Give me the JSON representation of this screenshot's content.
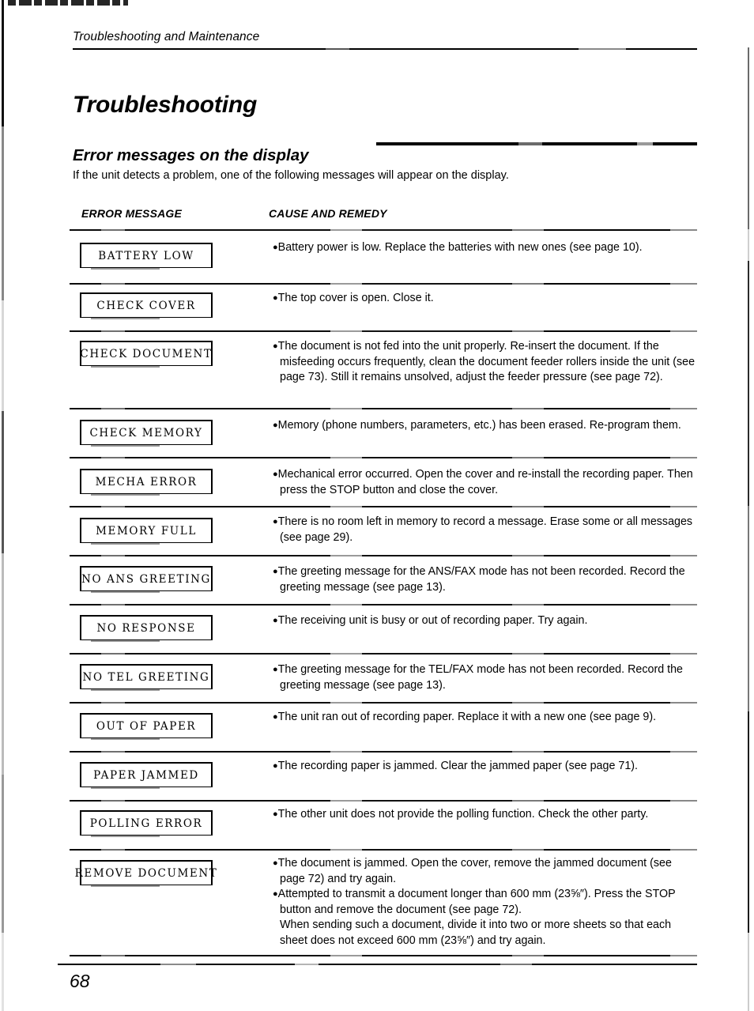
{
  "page": {
    "running_header": "Troubleshooting and Maintenance",
    "chapter_title": "Troubleshooting",
    "section_title": "Error messages on the display",
    "intro": "If the unit detects a problem, one of the following messages will appear on the display.",
    "page_number": "68"
  },
  "table": {
    "headers": {
      "error_message": "ERROR MESSAGE",
      "cause_and_remedy": "CAUSE AND REMEDY"
    },
    "rows": [
      {
        "display": "BATTERY LOW",
        "lines": [
          {
            "bullet": true,
            "text": "Battery power is low. Replace the batteries with new ones (see page 10)."
          }
        ]
      },
      {
        "display": "CHECK COVER",
        "lines": [
          {
            "bullet": true,
            "text": "The top cover is open. Close it."
          }
        ]
      },
      {
        "display": "CHECK DOCUMENT",
        "lines": [
          {
            "bullet": true,
            "text": "The document is not fed into the unit properly. Re-insert the document. If the misfeeding occurs frequently, clean the document feeder rollers inside the unit (see page 73). Still it remains unsolved, adjust the feeder pressure (see page 72)."
          }
        ]
      },
      {
        "display": "CHECK MEMORY",
        "lines": [
          {
            "bullet": true,
            "text": "Memory (phone numbers, parameters, etc.) has been erased. Re-program them."
          }
        ]
      },
      {
        "display": "MECHA ERROR",
        "lines": [
          {
            "bullet": true,
            "text": "Mechanical error occurred. Open the cover and re-install the recording paper. Then press the STOP button and close the cover."
          }
        ]
      },
      {
        "display": "MEMORY FULL",
        "lines": [
          {
            "bullet": true,
            "text": "There is no room left in memory to record a message. Erase some or all messages (see page 29)."
          }
        ]
      },
      {
        "display": "NO ANS GREETING",
        "lines": [
          {
            "bullet": true,
            "text": "The greeting message for the ANS/FAX mode has not been recorded. Record the greeting message (see page 13)."
          }
        ]
      },
      {
        "display": "NO RESPONSE",
        "lines": [
          {
            "bullet": true,
            "text": "The receiving unit is busy or out of recording paper. Try again."
          }
        ]
      },
      {
        "display": "NO TEL GREETING",
        "lines": [
          {
            "bullet": true,
            "text": "The greeting message for the TEL/FAX mode has not been recorded. Record the greeting message (see page 13)."
          }
        ]
      },
      {
        "display": "OUT OF PAPER",
        "lines": [
          {
            "bullet": true,
            "text": "The unit ran out of recording paper. Replace it with a new one (see page 9)."
          }
        ]
      },
      {
        "display": "PAPER JAMMED",
        "lines": [
          {
            "bullet": true,
            "text": "The recording paper is jammed. Clear the jammed paper (see page 71)."
          }
        ]
      },
      {
        "display": "POLLING ERROR",
        "lines": [
          {
            "bullet": true,
            "text": "The other unit does not provide the polling function. Check the other party."
          }
        ]
      },
      {
        "display": "REMOVE DOCUMENT",
        "lines": [
          {
            "bullet": true,
            "text": "The document is jammed. Open the cover, remove the jammed document (see page 72) and try again."
          },
          {
            "bullet": true,
            "text": "Attempted to transmit a document longer than 600 mm (23⅝″). Press the STOP button and remove the document (see page 72)."
          },
          {
            "bullet": false,
            "text": "When sending such a document, divide it into two or more sheets so that each sheet does not exceed 600 mm (23⅝″) and try again."
          }
        ]
      }
    ]
  }
}
